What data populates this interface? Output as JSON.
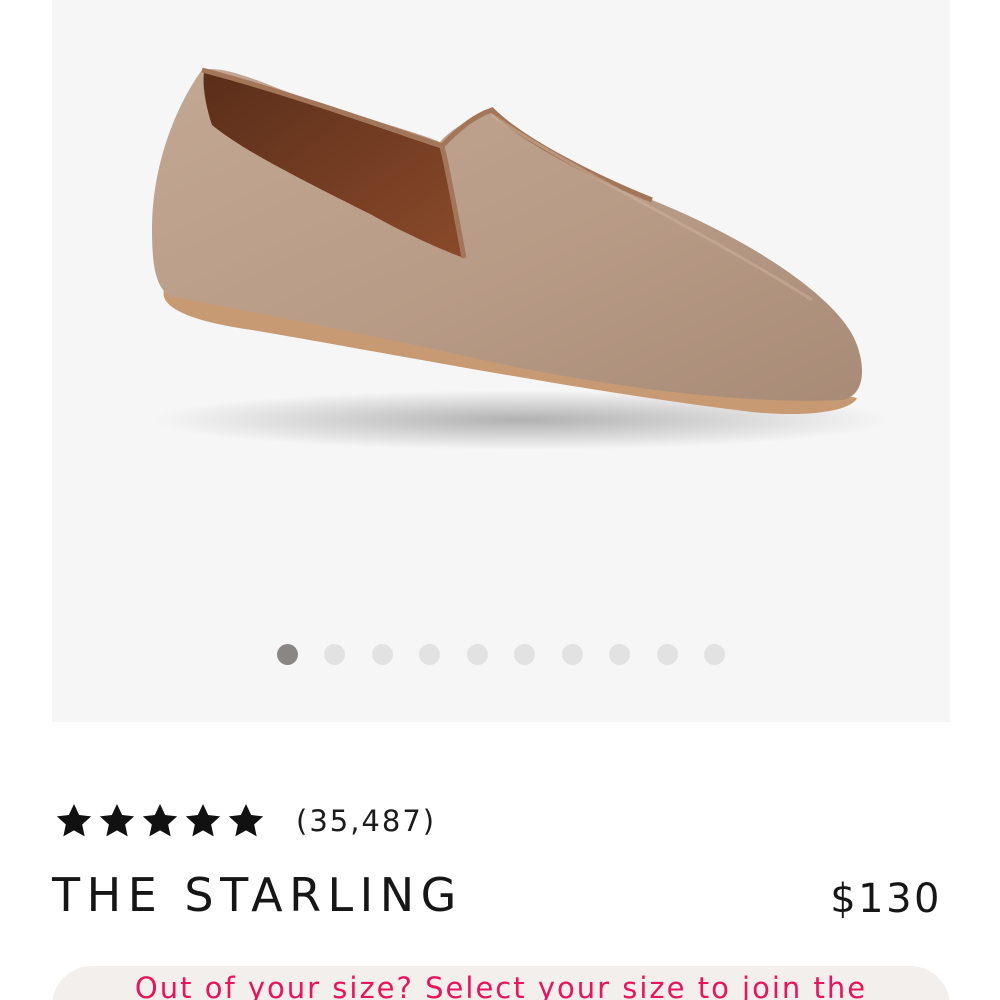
{
  "gallery": {
    "image_alt": "The Starling loafer in taupe suede",
    "dot_count": 10,
    "active_index": 0
  },
  "rating": {
    "stars": 5,
    "review_count": "(35,487)"
  },
  "product": {
    "name": "THE STARLING",
    "price": "$130"
  },
  "waitlist": {
    "text": "Out of your size? Select your size to join the"
  },
  "colors": {
    "accent": "#e5155e",
    "gallery_bg": "#f6f6f6",
    "dot_active": "#8a8686",
    "dot_inactive": "#e2e2e2"
  }
}
